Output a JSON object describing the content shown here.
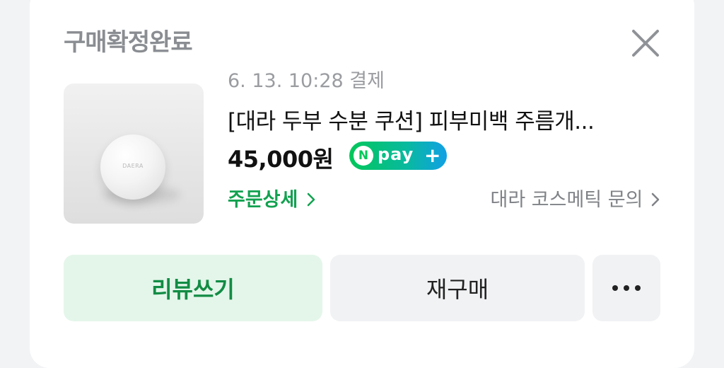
{
  "header": {
    "title": "구매확정완료",
    "close_icon": "close-icon"
  },
  "order": {
    "date": "6. 13. 10:28 결제",
    "product_name": "[대라 두부 수분 쿠션] 피부미백 주름개...",
    "price": "45,000원",
    "npay": {
      "n": "N",
      "pay": "pay",
      "plus": "+"
    },
    "order_detail_link": "주문상세",
    "inquiry_link": "대라 코스메틱 문의",
    "product_logo": "DAERA"
  },
  "actions": {
    "review": "리뷰쓰기",
    "rebuy": "재구매",
    "more_icon": "more-dots-icon"
  },
  "colors": {
    "accent_green": "#12a150",
    "review_bg": "#e4f6ea",
    "npay_green": "#03c75a",
    "npay_blue": "#11a0e6"
  }
}
